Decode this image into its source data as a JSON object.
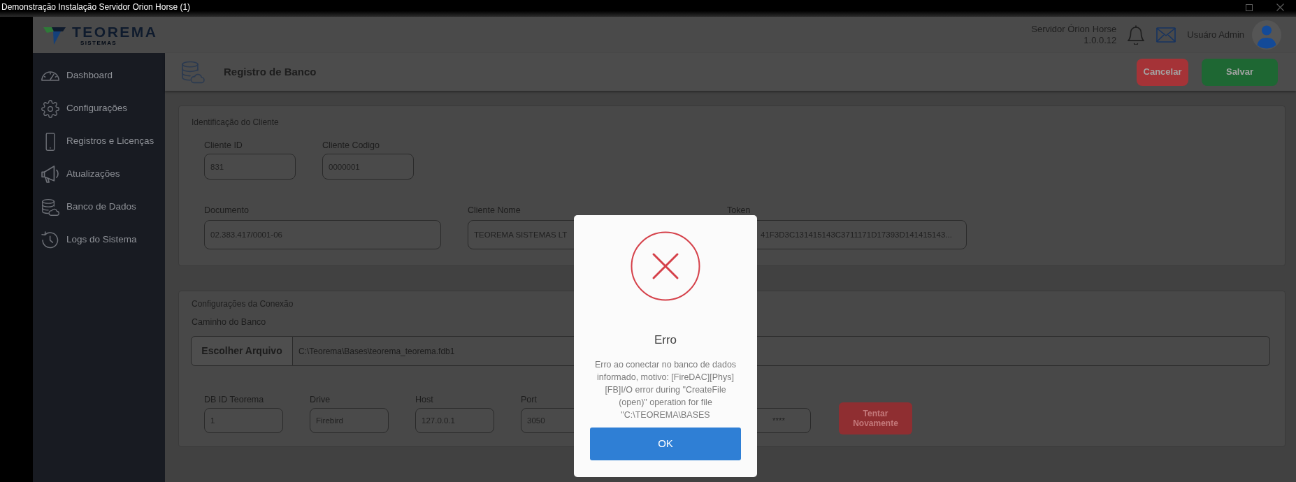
{
  "window": {
    "title": "Demonstração Instalação Servidor Orion Horse (1)"
  },
  "header": {
    "logo_name": "TEOREMA",
    "logo_tagline": "SISTEMAS",
    "server_name": "Servidor Órion Horse",
    "version": "1.0.0.12",
    "user_name": "Usuáro Admin"
  },
  "sidebar": {
    "items": [
      {
        "label": "Dashboard"
      },
      {
        "label": "Configurações"
      },
      {
        "label": "Registros e Licenças"
      },
      {
        "label": "Atualizações"
      },
      {
        "label": "Banco de Dados"
      },
      {
        "label": "Logs do Sistema"
      }
    ]
  },
  "page": {
    "title": "Registro de Banco",
    "actions": [
      {
        "label": "Cancelar",
        "kind": "danger"
      },
      {
        "label": "Salvar",
        "kind": "success"
      }
    ]
  },
  "client_section": {
    "title": "Identificação do Cliente",
    "rows": [
      [
        {
          "label": "Cliente ID",
          "value": "831"
        },
        {
          "label": "Cliente Codigo",
          "value": "0000001"
        }
      ],
      [
        {
          "label": "Documento",
          "value": "02.383.417/0001-06"
        },
        {
          "label": "Cliente Nome",
          "value": "TEOREMA SISTEMAS LT"
        },
        {
          "label": "Token",
          "value": "41F3D3C131415143C3711171D17393D141415143..."
        }
      ]
    ]
  },
  "connection_section": {
    "title": "Configurações da Conexão",
    "path_label": "Caminho do Banco",
    "choose_button": "Escolher Arquivo",
    "path_value": "C:\\Teorema\\Bases\\teorema_teorema.fdb1",
    "fields": [
      {
        "label": "DB ID Teorema",
        "value": "1"
      },
      {
        "label": "Drive",
        "value": "Firebird"
      },
      {
        "label": "Host",
        "value": "127.0.0.1"
      },
      {
        "label": "Port",
        "value": "3050"
      }
    ],
    "masked_field": {
      "value": "****"
    },
    "retry_button": "Tentar Novamente"
  },
  "dialog": {
    "title": "Erro",
    "message": "Erro ao conectar no banco de dados informado, motivo: [FireDAC][Phys][FB]I/O error during \"CreateFile (open)\" operation for file \"C:\\TEOREMA\\BASES",
    "button": "OK"
  }
}
